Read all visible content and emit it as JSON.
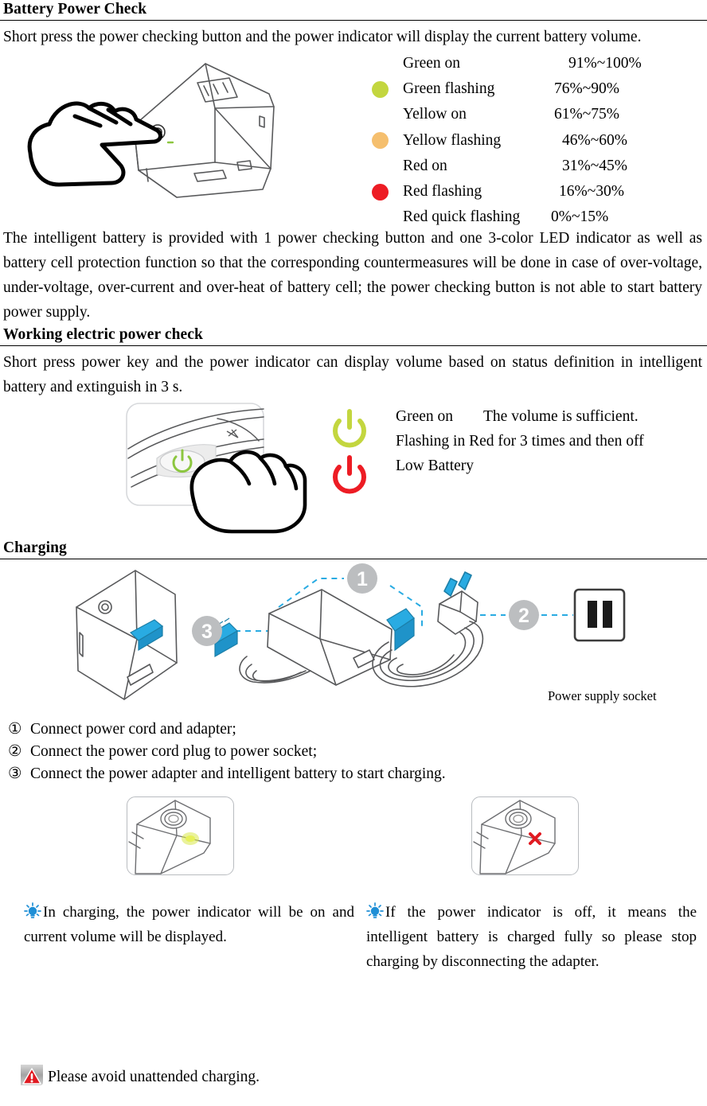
{
  "sections": {
    "battery_power_check": {
      "heading": "Battery Power Check",
      "intro": "Short press the power checking button and the power indicator will display the current battery volume.",
      "led_table": [
        {
          "state": "Green on",
          "range": "91%~100%",
          "dot": "none"
        },
        {
          "state": "Green flashing",
          "range": "76%~90%",
          "dot": "green"
        },
        {
          "state": "Yellow on",
          "range": "61%~75%",
          "dot": "none"
        },
        {
          "state": "Yellow flashing",
          "range": "46%~60%",
          "dot": "yellow"
        },
        {
          "state": "Red on",
          "range": "31%~45%",
          "dot": "none"
        },
        {
          "state": "Red flashing",
          "range": "16%~30%",
          "dot": "red"
        },
        {
          "state": "Red quick flashing",
          "range": "0%~15%",
          "dot": "none"
        }
      ],
      "description": "The intelligent battery is provided with 1 power checking button and one 3-color LED indicator as well as battery cell protection function so that the corresponding countermeasures will be done in case of over-voltage, under-voltage, over-current and over-heat of battery cell; the power checking button is not able to start battery power supply."
    },
    "working_power_check": {
      "heading": "Working electric power check",
      "intro": "Short press power key and the power indicator can display volume based on status definition in intelligent battery and extinguish in 3 s.",
      "legend": {
        "green_state": "Green on",
        "green_meaning": "The volume is sufficient.",
        "red_state": "Flashing in Red for 3 times and then off",
        "red_meaning": "Low Battery"
      }
    },
    "charging": {
      "heading": "Charging",
      "callouts": [
        "1",
        "2",
        "3"
      ],
      "socket_label": "Power supply socket",
      "steps": [
        {
          "num": "①",
          "text": "Connect power cord and adapter;"
        },
        {
          "num": "②",
          "text": "Connect the power cord plug to power socket;"
        },
        {
          "num": "③",
          "text": "Connect the power adapter and intelligent battery to start charging."
        }
      ],
      "tips": [
        {
          "icon": "bulb-icon",
          "text": "In charging, the power indicator will be on and current volume will be displayed."
        },
        {
          "icon": "bulb-icon",
          "text": "If the power indicator is off, it means the intelligent battery is charged fully so please stop charging by disconnecting the adapter."
        }
      ],
      "warning": {
        "icon": "warning-triangle-icon",
        "text": "Please avoid unattended charging."
      }
    }
  },
  "colors": {
    "led_green": "#c3d63f",
    "led_yellow": "#f5bf6e",
    "led_red": "#ed1c24",
    "accent_blue": "#29abe2",
    "callout_gray": "#bcbec0",
    "tip_blue": "#1f8fd6",
    "warn_red": "#e01b22",
    "warn_gray": "#9a9a9a"
  }
}
